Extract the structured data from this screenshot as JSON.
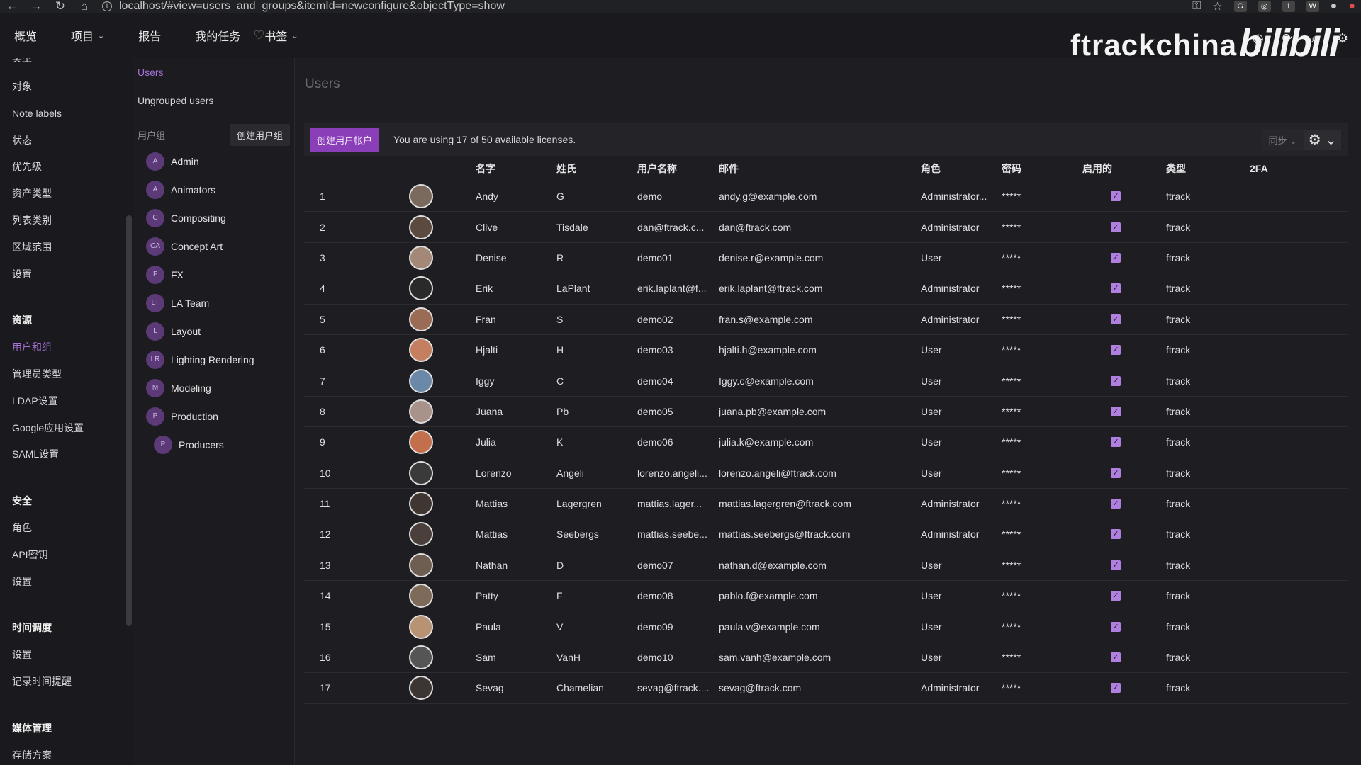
{
  "browser": {
    "url": "localhost/#view=users_and_groups&itemId=newconfigure&objectType=show",
    "nav_icons": [
      "←",
      "→",
      "↻",
      "⌂"
    ],
    "right_icons": [
      "⚿",
      "☆",
      "G",
      "◎",
      "1",
      "W",
      "●",
      "●"
    ]
  },
  "topnav": {
    "items": [
      {
        "label": "概览"
      },
      {
        "label": "项目",
        "dropdown": "⌄"
      },
      {
        "label": "报告"
      },
      {
        "label": "我的任务"
      },
      {
        "label": "书签",
        "dropdown": "⌄"
      }
    ],
    "bookmark_icon": "♡",
    "brand": "ftrackchina",
    "brand2": "bilibili",
    "icons": [
      "◷",
      "⟳",
      "⌕",
      "⚙"
    ]
  },
  "sidebar": {
    "items_top": [
      "类型",
      "对象",
      "Note labels",
      "状态",
      "优先级",
      "资产类型",
      "列表类别",
      "区域范围",
      "设置"
    ],
    "sections": [
      {
        "title": "资源",
        "items": [
          "用户和组",
          "管理员类型",
          "LDAP设置",
          "Google应用设置",
          "SAML设置"
        ]
      },
      {
        "title": "安全",
        "items": [
          "角色",
          "API密钥",
          "设置"
        ]
      },
      {
        "title": "时间调度",
        "items": [
          "设置",
          "记录时间提醒"
        ]
      },
      {
        "title": "媒体管理",
        "items": [
          "存储方案"
        ]
      }
    ]
  },
  "groups_panel": {
    "users_link": "Users",
    "ungrouped_link": "Ungrouped users",
    "header_label": "用户组",
    "create_button": "创建用户组",
    "groups": [
      {
        "abbr": "A",
        "name": "Admin"
      },
      {
        "abbr": "A",
        "name": "Animators"
      },
      {
        "abbr": "C",
        "name": "Compositing"
      },
      {
        "abbr": "CA",
        "name": "Concept Art"
      },
      {
        "abbr": "F",
        "name": "FX"
      },
      {
        "abbr": "LT",
        "name": "LA Team"
      },
      {
        "abbr": "L",
        "name": "Layout"
      },
      {
        "abbr": "LR",
        "name": "Lighting Rendering"
      },
      {
        "abbr": "M",
        "name": "Modeling"
      },
      {
        "abbr": "P",
        "name": "Production"
      },
      {
        "abbr": "P",
        "name": "Producers",
        "sub": true
      }
    ]
  },
  "main": {
    "title": "Users",
    "create_user_button": "创建用户帐户",
    "license_text": "You are using 17 of 50 available licenses.",
    "sync_label": "同步 ⌄",
    "gear_label": "⚙ ⌄",
    "columns": [
      "",
      "",
      "名字",
      "姓氏",
      "用户名称",
      "邮件",
      "角色",
      "密码",
      "启用的",
      "类型",
      "2FA"
    ],
    "rows": [
      [
        "1",
        "Andy",
        "G",
        "demo",
        "andy.g@example.com",
        "Administrator...",
        "*****",
        "ftrack"
      ],
      [
        "2",
        "Clive",
        "Tisdale",
        "dan@ftrack.c...",
        "dan@ftrack.com",
        "Administrator",
        "*****",
        "ftrack"
      ],
      [
        "3",
        "Denise",
        "R",
        "demo01",
        "denise.r@example.com",
        "User",
        "*****",
        "ftrack"
      ],
      [
        "4",
        "Erik",
        "LaPlant",
        "erik.laplant@f...",
        "erik.laplant@ftrack.com",
        "Administrator",
        "*****",
        "ftrack"
      ],
      [
        "5",
        "Fran",
        "S",
        "demo02",
        "fran.s@example.com",
        "Administrator",
        "*****",
        "ftrack"
      ],
      [
        "6",
        "Hjalti",
        "H",
        "demo03",
        "hjalti.h@example.com",
        "User",
        "*****",
        "ftrack"
      ],
      [
        "7",
        "Iggy",
        "C",
        "demo04",
        "Iggy.c@example.com",
        "User",
        "*****",
        "ftrack"
      ],
      [
        "8",
        "Juana",
        "Pb",
        "demo05",
        "juana.pb@example.com",
        "User",
        "*****",
        "ftrack"
      ],
      [
        "9",
        "Julia",
        "K",
        "demo06",
        "julia.k@example.com",
        "User",
        "*****",
        "ftrack"
      ],
      [
        "10",
        "Lorenzo",
        "Angeli",
        "lorenzo.angeli...",
        "lorenzo.angeli@ftrack.com",
        "User",
        "*****",
        "ftrack"
      ],
      [
        "11",
        "Mattias",
        "Lagergren",
        "mattias.lager...",
        "mattias.lagergren@ftrack.com",
        "Administrator",
        "*****",
        "ftrack"
      ],
      [
        "12",
        "Mattias",
        "Seebergs",
        "mattias.seebe...",
        "mattias.seebergs@ftrack.com",
        "Administrator",
        "*****",
        "ftrack"
      ],
      [
        "13",
        "Nathan",
        "D",
        "demo07",
        "nathan.d@example.com",
        "User",
        "*****",
        "ftrack"
      ],
      [
        "14",
        "Patty",
        "F",
        "demo08",
        "pablo.f@example.com",
        "User",
        "*****",
        "ftrack"
      ],
      [
        "15",
        "Paula",
        "V",
        "demo09",
        "paula.v@example.com",
        "User",
        "*****",
        "ftrack"
      ],
      [
        "16",
        "Sam",
        "VanH",
        "demo10",
        "sam.vanh@example.com",
        "User",
        "*****",
        "ftrack"
      ],
      [
        "17",
        "Sevag",
        "Chamelian",
        "sevag@ftrack....",
        "sevag@ftrack.com",
        "Administrator",
        "*****",
        "ftrack"
      ]
    ],
    "enabled_mark": "✓"
  },
  "colors": {
    "accent": "#a46fd6",
    "button": "#8a3fb8"
  }
}
